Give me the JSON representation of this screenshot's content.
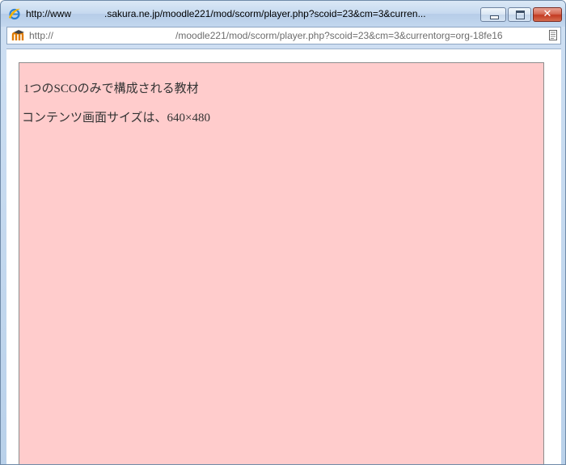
{
  "window": {
    "title_prefix": "http://www",
    "title_suffix": ".sakura.ne.jp/moodle221/mod/scorm/player.php?scoid=23&cm=3&curren..."
  },
  "addressbar": {
    "url_prefix": "http://",
    "url_suffix": "/moodle221/mod/scorm/player.php?scoid=23&cm=3&currentorg=org-18fe16"
  },
  "content": {
    "heading": "1つのSCOのみで構成される教材",
    "subtext": "コンテンツ画面サイズは、640×480"
  },
  "colors": {
    "content_background": "#ffcccc",
    "close_button": "#c33b22"
  },
  "icons": {
    "browser": "ie-icon",
    "site": "moodle-icon",
    "page": "page-icon"
  }
}
